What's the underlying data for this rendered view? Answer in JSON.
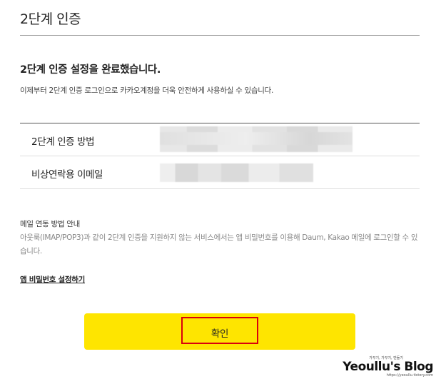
{
  "page": {
    "title": "2단계 인증"
  },
  "result": {
    "headline": "2단계 인증 설정을 완료했습니다.",
    "description": "이제부터 2단계 인증 로그인으로 카카오계정을 더욱 안전하게 사용하실 수 있습니다."
  },
  "info_table": {
    "rows": [
      {
        "label": "2단계 인증 방법",
        "value": ""
      },
      {
        "label": "비상연락용 이메일",
        "value": ""
      }
    ]
  },
  "mail_guide": {
    "title": "메일 연동 방법 안내",
    "body": "아웃룩(IMAP/POP3)과 같이 2단계 인증을 지원하지 않는 서비스에서는 앱 비밀번호를 이용해 Daum, Kakao 메일에 로그인할 수 있습니다."
  },
  "links": {
    "app_password": "앱 비밀번호 설정하기"
  },
  "actions": {
    "confirm_label": "확인"
  },
  "watermark": {
    "tagline": "가꾸기, 가꾸기, 만들기",
    "name": "Yeoullu's Blog",
    "url": "https://yeoullu.tistory.com"
  },
  "colors": {
    "confirm_button_bg": "#fee500",
    "highlight_border": "#d9000d",
    "divider": "#dddddd"
  }
}
